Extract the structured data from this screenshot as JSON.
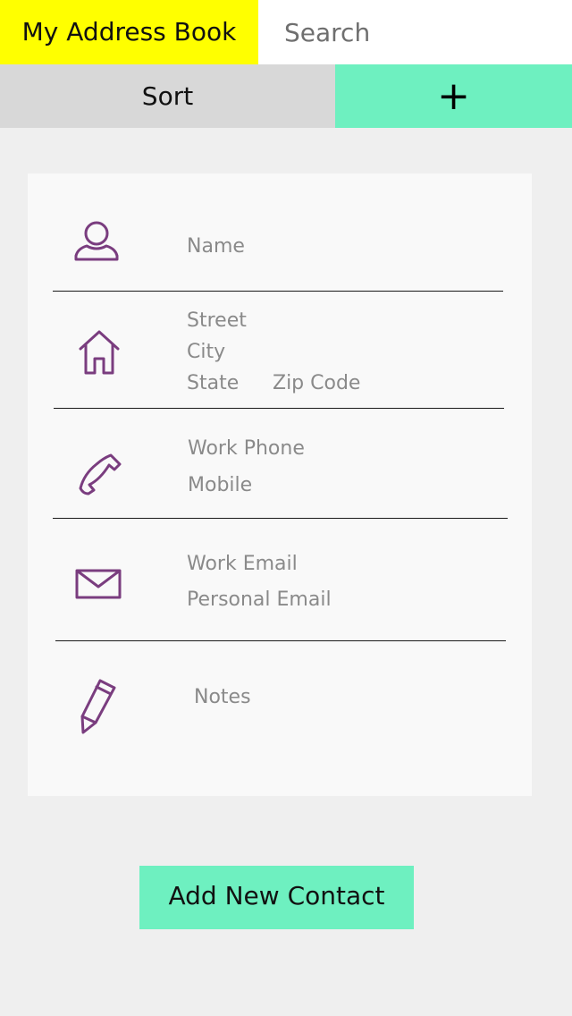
{
  "header": {
    "app_title": "My Address Book",
    "search_placeholder": "Search"
  },
  "toolbar": {
    "sort_label": "Sort",
    "add_label": "+"
  },
  "form": {
    "fields": {
      "name": "Name",
      "street": "Street",
      "city": "City",
      "state": "State",
      "zip_code": "Zip Code",
      "work_phone": "Work Phone",
      "mobile": "Mobile",
      "work_email": "Work Email",
      "personal_email": "Personal Email",
      "notes": "Notes"
    },
    "icons": [
      "person-icon",
      "home-icon",
      "phone-icon",
      "mail-icon",
      "pencil-icon"
    ]
  },
  "footer": {
    "add_contact_label": "Add New Contact"
  },
  "colors": {
    "title_bg": "#ffff00",
    "accent": "#6ef0c0",
    "sort_bg": "#d8d8d8",
    "icon": "#7a3d7f",
    "field_text": "#8a8a8a",
    "background": "#efefef",
    "card_bg": "#f9f9f9"
  }
}
